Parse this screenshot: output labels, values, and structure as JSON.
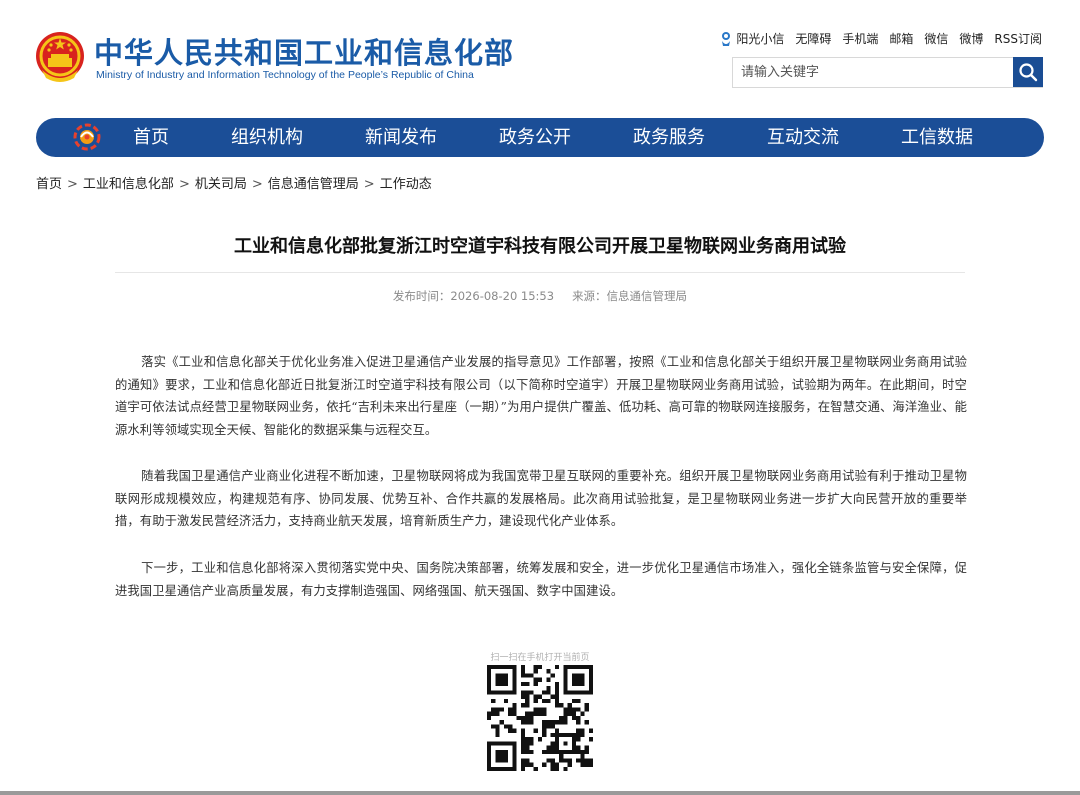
{
  "site": {
    "title_cn": "中华人民共和国工业和信息化部",
    "title_en": "Ministry of Industry and Information Technology of the People’s Republic of China"
  },
  "toplinks": [
    "阳光小信",
    "无障碍",
    "手机端",
    "邮箱",
    "微信",
    "微博",
    "RSS订阅"
  ],
  "search": {
    "placeholder": "请输入关键字"
  },
  "nav": [
    "首页",
    "组织机构",
    "新闻发布",
    "政务公开",
    "政务服务",
    "互动交流",
    "工信数据"
  ],
  "breadcrumb": [
    "首页",
    "工业和信息化部",
    "机关司局",
    "信息通信管理局",
    "工作动态"
  ],
  "breadcrumb_sep": ">",
  "article": {
    "title": "工业和信息化部批复浙江时空道宇科技有限公司开展卫星物联网业务商用试验",
    "date_label": "发布时间：",
    "date": "2026-08-20 15:53",
    "source_label": "来源：",
    "source": "信息通信管理局",
    "paragraphs": [
      "落实《工业和信息化部关于优化业务准入促进卫星通信产业发展的指导意见》工作部署，按照《工业和信息化部关于组织开展卫星物联网业务商用试验的通知》要求，工业和信息化部近日批复浙江时空道宇科技有限公司（以下简称时空道宇）开展卫星物联网业务商用试验，试验期为两年。在此期间，时空道宇可依法试点经营卫星物联网业务，依托“吉利未来出行星座（一期）”为用户提供广覆盖、低功耗、高可靠的物联网连接服务，在智慧交通、海洋渔业、能源水利等领域实现全天候、智能化的数据采集与远程交互。",
      "随着我国卫星通信产业商业化进程不断加速，卫星物联网将成为我国宽带卫星互联网的重要补充。组织开展卫星物联网业务商用试验有利于推动卫星物联网形成规模效应，构建规范有序、协同发展、优势互补、合作共赢的发展格局。此次商用试验批复，是卫星物联网业务进一步扩大向民营开放的重要举措，有助于激发民营经济活力，支持商业航天发展，培育新质生产力，建设现代化产业体系。",
      "下一步，工业和信息化部将深入贯彻落实党中央、国务院决策部署，统筹发展和安全，进一步优化卫星通信市场准入，强化全链条监管与安全保障，促进我国卫星通信产业高质量发展，有力支撑制造强国、网络强国、航天强国、数字中国建设。"
    ]
  },
  "qr": {
    "caption": "扫一扫在手机打开当前页"
  },
  "colors": {
    "brand_blue": "#1b4e97",
    "title_blue": "#1a5ba7",
    "emblem_red": "#d8231e",
    "emblem_gold": "#f5c518"
  },
  "icons": [
    "national-emblem-icon",
    "sun-mascot-icon",
    "search-icon",
    "nav-logo-icon",
    "qr-code"
  ]
}
